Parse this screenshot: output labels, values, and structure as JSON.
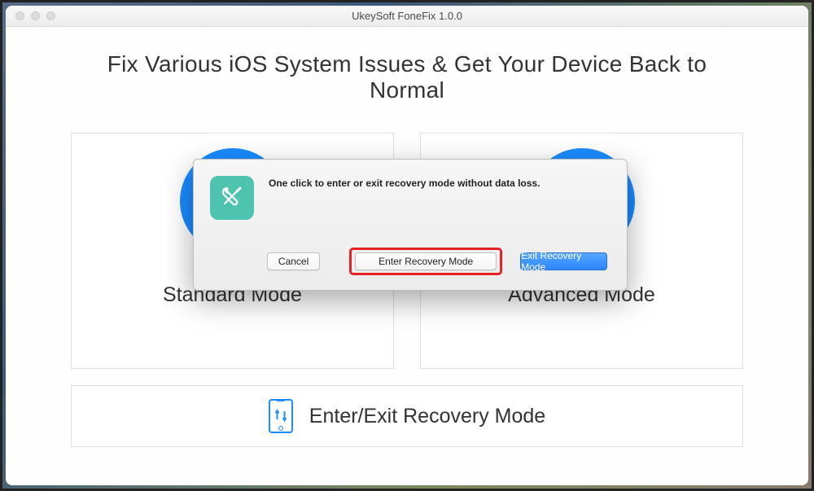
{
  "titlebar": {
    "title": "UkeySoft FoneFix 1.0.0"
  },
  "main": {
    "heading": "Fix Various iOS System Issues & Get Your Device Back to Normal",
    "modes": [
      {
        "label": "Standard Mode"
      },
      {
        "label": "Advanced Mode"
      }
    ],
    "recovery_bar_label": "Enter/Exit Recovery Mode"
  },
  "dialog": {
    "title": "One click to enter or exit recovery mode without data loss.",
    "buttons": {
      "cancel": "Cancel",
      "enter": "Enter Recovery Mode",
      "exit": "Exit Recovery Mode"
    }
  },
  "colors": {
    "accent_blue": "#1a8cff",
    "dialog_icon_bg": "#4ec3b0",
    "primary_button": "#2e86ff",
    "highlight_border": "#e52323"
  }
}
